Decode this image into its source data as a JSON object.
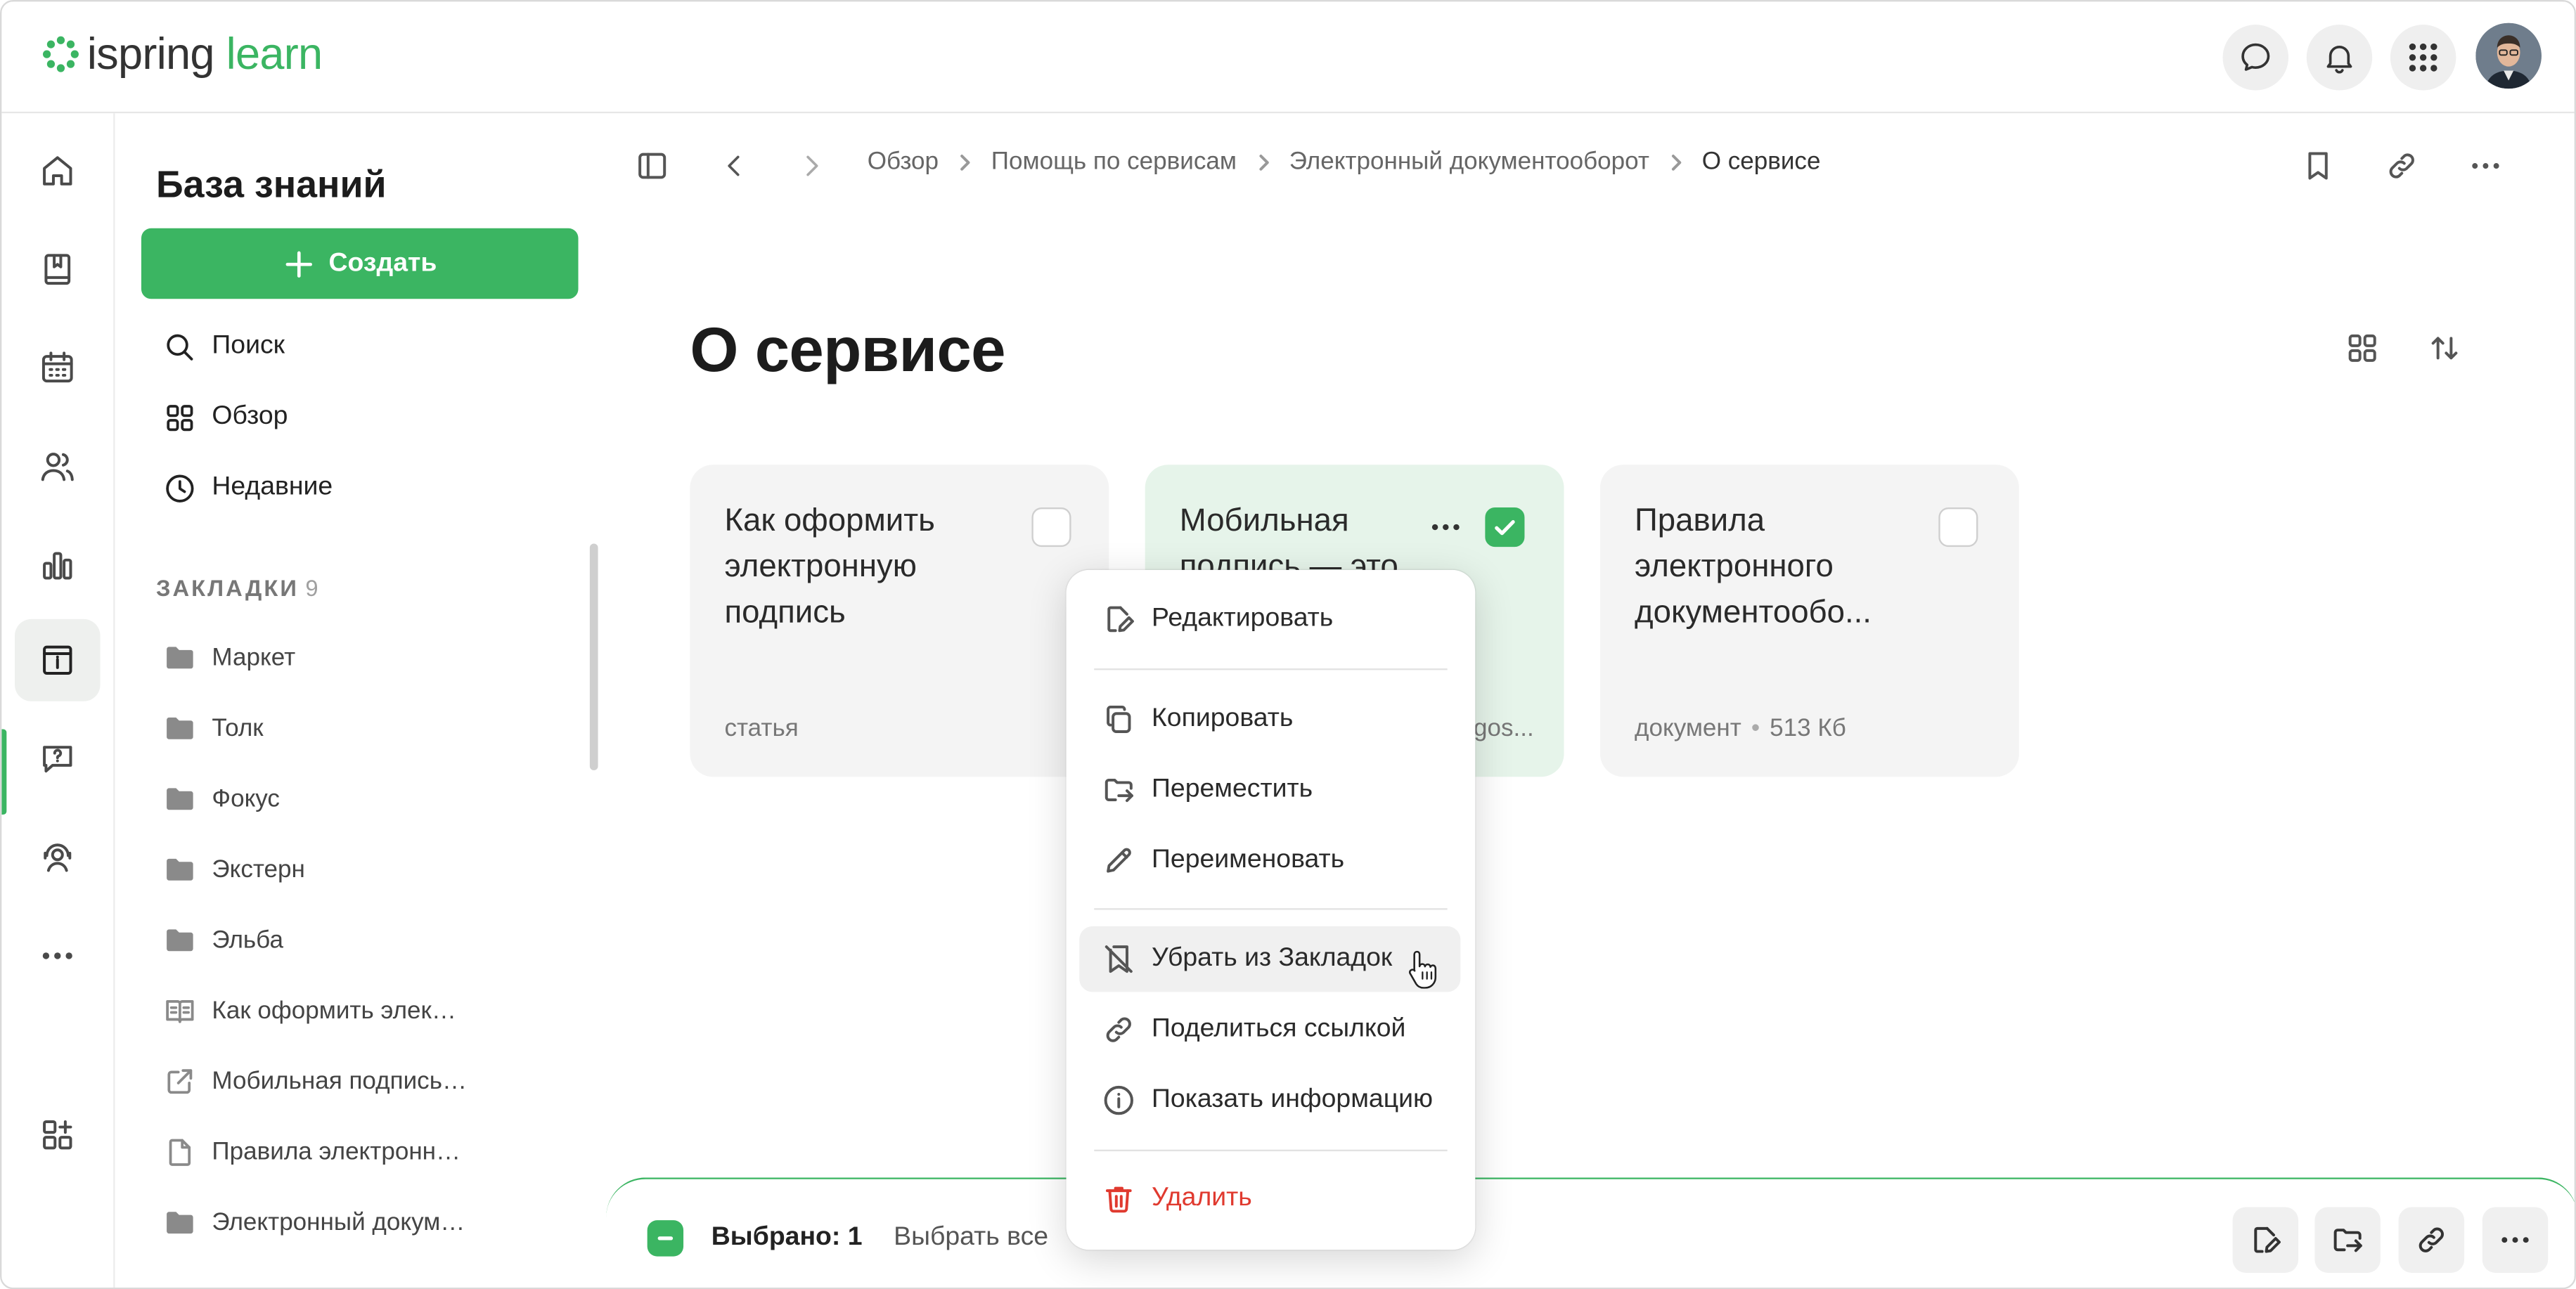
{
  "header": {
    "logo_primary": "ispring",
    "logo_secondary": "learn",
    "icons": [
      "chat-icon",
      "bell-icon",
      "apps-grid-icon"
    ]
  },
  "rail": {
    "icons": [
      "home-icon",
      "book-icon",
      "calendar-icon",
      "people-icon",
      "chart-icon",
      "info-card-icon",
      "help-chat-icon",
      "support-icon",
      "more-icon",
      "add-widget-icon"
    ],
    "active": "info-card-icon"
  },
  "sidebar": {
    "title": "База знаний",
    "create_label": "Создать",
    "nav": [
      {
        "label": "Поиск",
        "icon": "search-icon"
      },
      {
        "label": "Обзор",
        "icon": "grid-icon"
      },
      {
        "label": "Недавние",
        "icon": "clock-icon"
      }
    ],
    "bookmarks_label": "ЗАКЛАДКИ",
    "bookmarks_count": "9",
    "bookmarks": [
      {
        "label": "Маркет",
        "icon": "folder-icon"
      },
      {
        "label": "Толк",
        "icon": "folder-icon"
      },
      {
        "label": "Фокус",
        "icon": "folder-icon"
      },
      {
        "label": "Экстерн",
        "icon": "folder-icon"
      },
      {
        "label": "Эльба",
        "icon": "folder-icon"
      },
      {
        "label": "Как оформить элек…",
        "icon": "article-icon"
      },
      {
        "label": "Мобильная подпись…",
        "icon": "external-link-icon"
      },
      {
        "label": "Правила электронн…",
        "icon": "document-icon"
      },
      {
        "label": "Электронный докум…",
        "icon": "folder-icon"
      }
    ]
  },
  "breadcrumb": [
    "Обзор",
    "Помощь по сервисам",
    "Электронный документооборот",
    "О сервисе"
  ],
  "page": {
    "title": "О сервисе"
  },
  "cards": [
    {
      "title": "Как оформить электронную подпись",
      "type": "статья",
      "size": "",
      "selected": false
    },
    {
      "title": "Мобильная подпись — это",
      "type": "",
      "size": "",
      "meta_tail": "gos...",
      "selected": true
    },
    {
      "title": "Правила электронного документообо...",
      "type": "документ",
      "size": "513 Кб",
      "selected": false
    }
  ],
  "context_menu": {
    "items": [
      {
        "label": "Редактировать",
        "icon": "edit-doc-icon"
      },
      {
        "label": "Копировать",
        "icon": "copy-icon"
      },
      {
        "label": "Переместить",
        "icon": "move-icon"
      },
      {
        "label": "Переименовать",
        "icon": "pencil-icon"
      },
      {
        "label": "Убрать из Закладок",
        "icon": "bookmark-off-icon",
        "hovered": true
      },
      {
        "label": "Поделиться ссылкой",
        "icon": "link-icon"
      },
      {
        "label": "Показать информацию",
        "icon": "info-icon"
      },
      {
        "label": "Удалить",
        "icon": "trash-icon",
        "color": "#e03a2f"
      }
    ]
  },
  "selection_bar": {
    "count_label": "Выбрано: 1",
    "select_all_label": "Выбрать все"
  },
  "colors": {
    "accent": "#3bb562",
    "danger": "#e03a2f",
    "selected_card": "#e6f4ea"
  }
}
